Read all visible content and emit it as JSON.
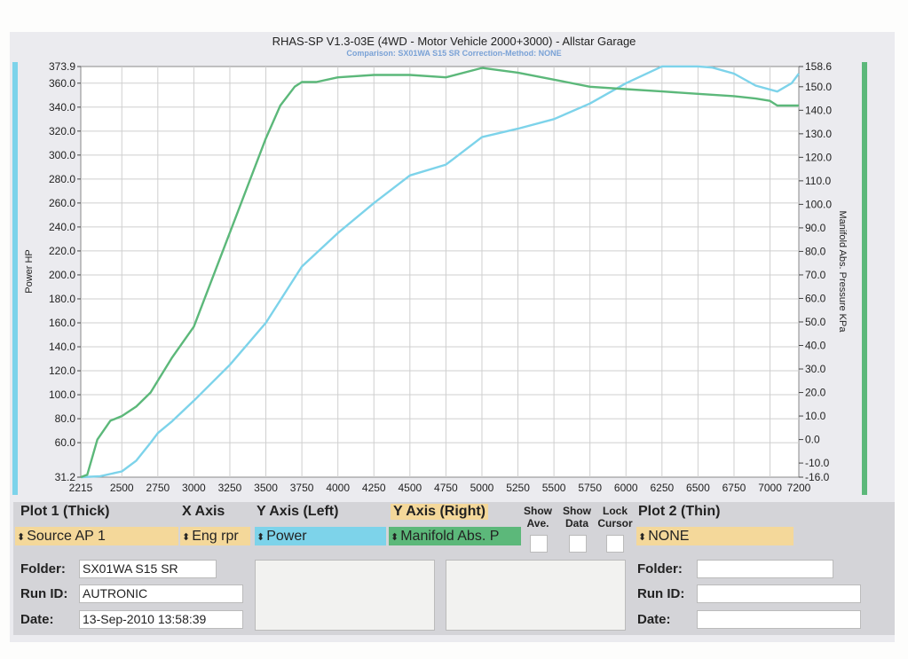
{
  "title": "RHAS-SP V1.3-03E  (4WD - Motor Vehicle 2000+3000) - Allstar Garage",
  "subtitle": "Comparison: SX01WA S15 SR   Correction-Method: NONE",
  "colors": {
    "power": "#7dd3ea",
    "map": "#5cb87a",
    "source": "#f4d89a",
    "right_hdr": "#f4d89a"
  },
  "chart_data": {
    "type": "line",
    "xlabel": "",
    "ylabel": "Power HP",
    "y2label": "Manifold Abs. Pressure KPa",
    "xlim": [
      2215,
      7200
    ],
    "ylim": [
      31.2,
      373.9
    ],
    "y2lim": [
      -16.0,
      158.6
    ],
    "x_ticks": [
      "2215",
      "2500",
      "2750",
      "3000",
      "3250",
      "3500",
      "3750",
      "4000",
      "4250",
      "4500",
      "4750",
      "5000",
      "5250",
      "5500",
      "5750",
      "6000",
      "6250",
      "6500",
      "6750",
      "7000",
      "7200"
    ],
    "y_ticks": [
      31.2,
      60.0,
      80.0,
      100.0,
      120.0,
      140.0,
      160.0,
      180.0,
      200.0,
      220.0,
      240.0,
      260.0,
      280.0,
      300.0,
      320.0,
      340.0,
      360.0,
      373.9
    ],
    "y_tick_labels": [
      "31.2",
      "60.0",
      "80.0",
      "100.0",
      "120.0",
      "140.0",
      "160.0",
      "180.0",
      "200.0",
      "220.0",
      "240.0",
      "260.0",
      "280.0",
      "300.0",
      "320.0",
      "340.0",
      "360.0",
      "373.9"
    ],
    "y2_ticks": [
      -16.0,
      -10.0,
      0.0,
      10.0,
      20.0,
      30.0,
      40.0,
      50.0,
      60.0,
      70.0,
      80.0,
      90.0,
      100.0,
      110.0,
      120.0,
      130.0,
      140.0,
      150.0,
      158.6
    ],
    "y2_tick_labels": [
      "-16.0",
      "-10.0",
      "0.0",
      "10.0",
      "20.0",
      "30.0",
      "40.0",
      "50.0",
      "60.0",
      "70.0",
      "80.0",
      "90.0",
      "100.0",
      "110.0",
      "120.0",
      "130.0",
      "140.0",
      "150.0",
      "158.6"
    ],
    "grid": true,
    "series": [
      {
        "name": "Power",
        "axis": "left",
        "color": "#7dd3ea",
        "x": [
          2215,
          2350,
          2500,
          2600,
          2700,
          2750,
          2850,
          3000,
          3250,
          3500,
          3750,
          4000,
          4250,
          4500,
          4750,
          5000,
          5250,
          5500,
          5750,
          6000,
          6250,
          6500,
          6600,
          6750,
          6900,
          7050,
          7150,
          7200
        ],
        "y": [
          31.2,
          32,
          36,
          45,
          60,
          68,
          78,
          95,
          125,
          160,
          207,
          235,
          260,
          283,
          292,
          315,
          322,
          330,
          343,
          360,
          374,
          374,
          373,
          368,
          358,
          353,
          360,
          368
        ]
      },
      {
        "name": "Manifold Abs. P",
        "axis": "right",
        "color": "#5cb87a",
        "x": [
          2215,
          2260,
          2330,
          2420,
          2500,
          2600,
          2700,
          2750,
          2850,
          3000,
          3250,
          3500,
          3600,
          3700,
          3750,
          3850,
          4000,
          4250,
          4500,
          4750,
          5000,
          5250,
          5500,
          5750,
          6000,
          6250,
          6500,
          6750,
          6900,
          7000,
          7050,
          7200
        ],
        "y": [
          -16,
          -15,
          0,
          8,
          10,
          14,
          20,
          25,
          35,
          48,
          88,
          128,
          142,
          150,
          152,
          152,
          154,
          155,
          155,
          154,
          158,
          156,
          153,
          150,
          149,
          148,
          147,
          146,
          145,
          144,
          142,
          142
        ]
      }
    ]
  },
  "controls": {
    "plot1": "Plot 1 (Thick)",
    "xaxis": "X Axis",
    "yleft": "Y Axis (Left)",
    "yright": "Y Axis (Right)",
    "show_ave": "Show Ave.",
    "show_data": "Show Data",
    "lock_cursor": "Lock Cursor",
    "plot2": "Plot 2 (Thin)",
    "source": "Source AP 1",
    "xaxis_val": "Eng rpr",
    "yleft_val": "Power",
    "yright_val": "Manifold Abs. P",
    "plot2_val": "NONE",
    "folder_label": "Folder:",
    "runid_label": "Run ID:",
    "date_label": "Date:",
    "folder1": "SX01WA S15 SR",
    "runid1": "AUTRONIC",
    "date1": "13-Sep-2010  13:58:39",
    "folder2": "",
    "runid2": "",
    "date2": ""
  }
}
